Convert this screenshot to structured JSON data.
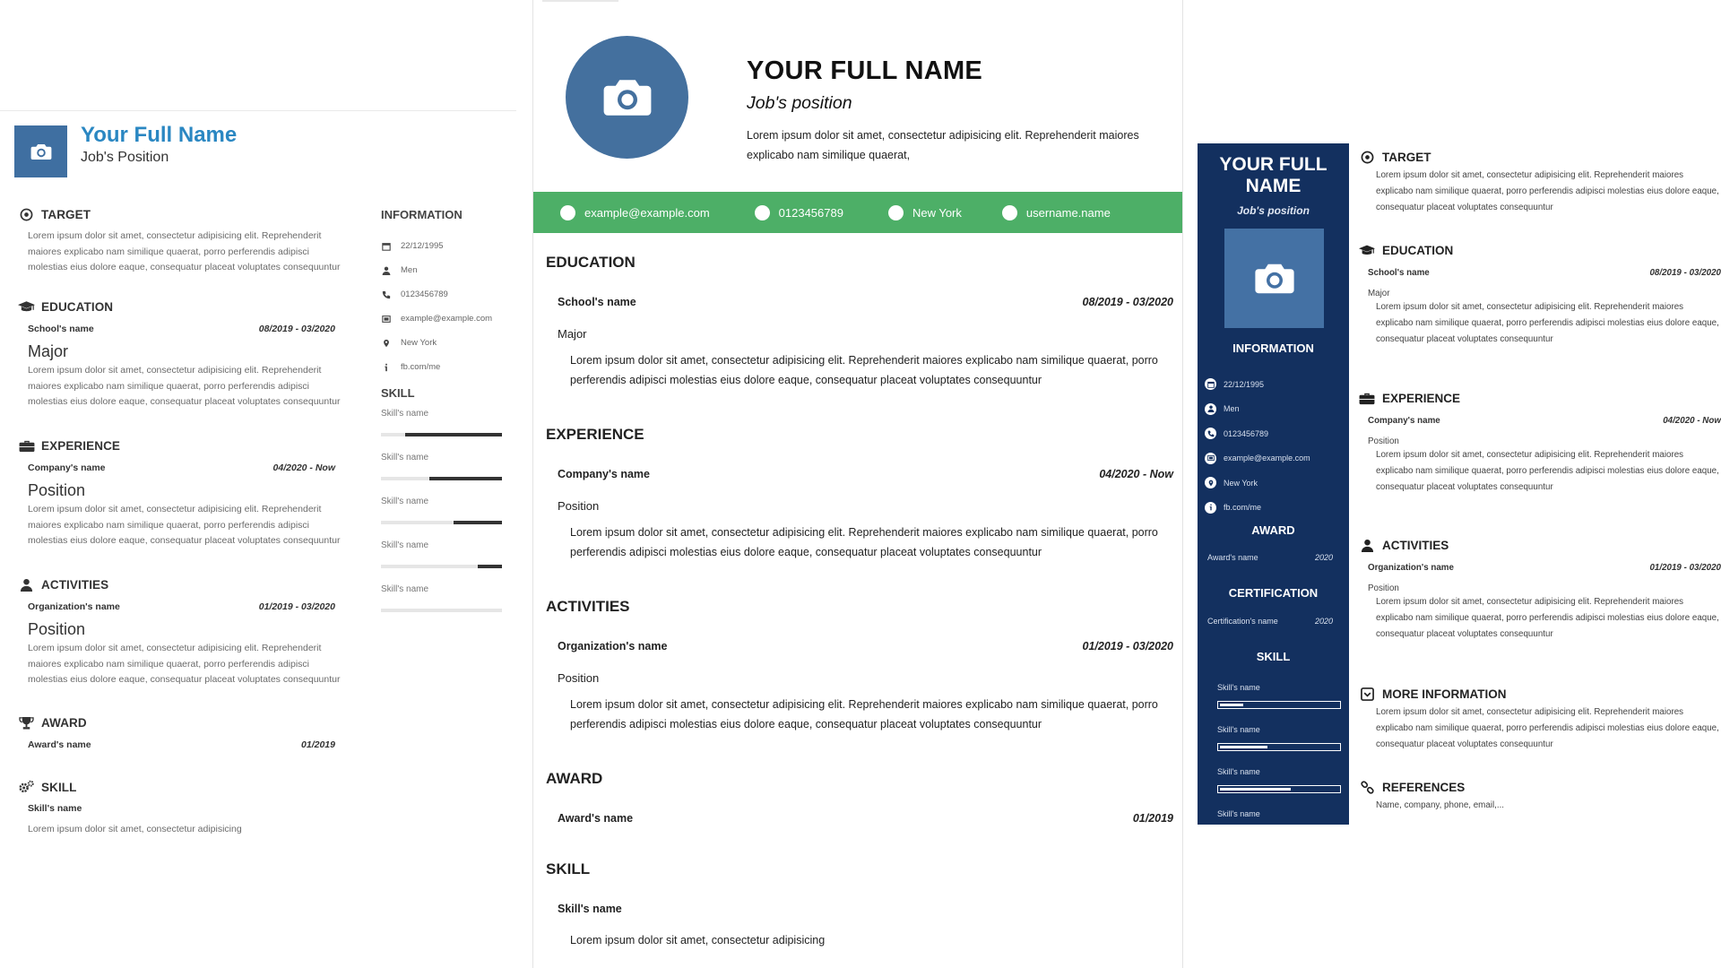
{
  "colors": {
    "cv1_accent": "#2a87c2",
    "cv1_photo_bg": "#3f6fa1",
    "cv2_photo_bg": "#44709e",
    "cv2_contact_bar": "#4daf67",
    "cv3_sidebar": "#13305f",
    "cv3_photo_bg": "#4471a4"
  },
  "icons": {
    "photo": "camera-icon",
    "target": "target-icon",
    "education": "graduation-cap-icon",
    "experience": "briefcase-icon",
    "activities": "user-icon",
    "award": "trophy-icon",
    "skill": "gears-icon",
    "more": "inbox-icon",
    "references": "link-icon"
  },
  "cv1": {
    "name": "Your Full Name",
    "position": "Job's Position",
    "target": {
      "title": "TARGET",
      "text": "Lorem ipsum dolor sit amet, consectetur adipisicing elit. Reprehenderit maiores explicabo nam similique quaerat, porro perferendis adipisci molestias eius dolore eaque, consequatur placeat voluptates consequuntur"
    },
    "education": {
      "title": "EDUCATION",
      "org": "School's name",
      "date": "08/2019 - 03/2020",
      "major": "Major",
      "text": "Lorem ipsum dolor sit amet, consectetur adipisicing elit. Reprehenderit maiores explicabo nam similique quaerat, porro perferendis adipisci molestias eius dolore eaque, consequatur placeat voluptates consequuntur"
    },
    "experience": {
      "title": "EXPERIENCE",
      "org": "Company's name",
      "date": "04/2020 - Now",
      "position": "Position",
      "text": "Lorem ipsum dolor sit amet, consectetur adipisicing elit. Reprehenderit maiores explicabo nam similique quaerat, porro perferendis adipisci molestias eius dolore eaque, consequatur placeat voluptates consequuntur"
    },
    "activities": {
      "title": "ACTIVITIES",
      "org": "Organization's name",
      "date": "01/2019 - 03/2020",
      "position": "Position",
      "text": "Lorem ipsum dolor sit amet, consectetur adipisicing elit. Reprehenderit maiores explicabo nam similique quaerat, porro perferendis adipisci molestias eius dolore eaque, consequatur placeat voluptates consequuntur"
    },
    "award": {
      "title": "AWARD",
      "name": "Award's name",
      "date": "01/2019"
    },
    "skill": {
      "title": "SKILL",
      "name": "Skill's name",
      "text": "Lorem ipsum dolor sit amet, consectetur adipisicing"
    },
    "information": {
      "title": "INFORMATION",
      "items": [
        {
          "icon": "calendar-icon",
          "text": "22/12/1995"
        },
        {
          "icon": "user-icon",
          "text": "Men"
        },
        {
          "icon": "phone-icon",
          "text": "0123456789"
        },
        {
          "icon": "envelope-icon",
          "text": "example@example.com"
        },
        {
          "icon": "map-pin-icon",
          "text": "New York"
        },
        {
          "icon": "info-icon",
          "text": "fb.com/me"
        }
      ]
    },
    "skills": {
      "title": "SKILL",
      "items": [
        {
          "label": "Skill's name",
          "level": 0.8
        },
        {
          "label": "Skill's name",
          "level": 0.6
        },
        {
          "label": "Skill's name",
          "level": 0.4
        },
        {
          "label": "Skill's name",
          "level": 0.2
        },
        {
          "label": "Skill's name",
          "level": 0.0
        }
      ]
    }
  },
  "cv2": {
    "name": "YOUR FULL NAME",
    "position": "Job's position",
    "summary": "Lorem ipsum dolor sit amet, consectetur adipisicing elit. Reprehenderit maiores explicabo nam similique quaerat,",
    "contacts": [
      "example@example.com",
      "0123456789",
      "New York",
      "username.name"
    ],
    "education": {
      "title": "EDUCATION",
      "org": "School's name",
      "date": "08/2019 - 03/2020",
      "sub": "Major",
      "text": "Lorem ipsum dolor sit amet, consectetur adipisicing elit. Reprehenderit maiores explicabo nam similique quaerat, porro perferendis adipisci molestias eius dolore eaque, consequatur placeat voluptates consequuntur"
    },
    "experience": {
      "title": "EXPERIENCE",
      "org": "Company's name",
      "date": "04/2020 - Now",
      "sub": "Position",
      "text": "Lorem ipsum dolor sit amet, consectetur adipisicing elit. Reprehenderit maiores explicabo nam similique quaerat, porro perferendis adipisci molestias eius dolore eaque, consequatur placeat voluptates consequuntur"
    },
    "activities": {
      "title": "ACTIVITIES",
      "org": "Organization's name",
      "date": "01/2019 - 03/2020",
      "sub": "Position",
      "text": "Lorem ipsum dolor sit amet, consectetur adipisicing elit. Reprehenderit maiores explicabo nam similique quaerat, porro perferendis adipisci molestias eius dolore eaque, consequatur placeat voluptates consequuntur"
    },
    "award": {
      "title": "AWARD",
      "name": "Award's name",
      "date": "01/2019"
    },
    "skill": {
      "title": "SKILL",
      "name": "Skill's name",
      "text": "Lorem ipsum dolor sit amet, consectetur adipisicing"
    }
  },
  "cv3": {
    "name_line1": "YOUR FULL",
    "name_line2": "NAME",
    "position": "Job's position",
    "information": {
      "title": "INFORMATION",
      "items": [
        {
          "icon": "calendar-icon",
          "text": "22/12/1995"
        },
        {
          "icon": "user-icon",
          "text": "Men"
        },
        {
          "icon": "phone-icon",
          "text": "0123456789"
        },
        {
          "icon": "envelope-icon",
          "text": "example@example.com"
        },
        {
          "icon": "map-pin-icon",
          "text": "New York"
        },
        {
          "icon": "info-icon",
          "text": "fb.com/me"
        }
      ]
    },
    "award": {
      "title": "AWARD",
      "name": "Award's name",
      "date": "2020"
    },
    "certification": {
      "title": "CERTIFICATION",
      "name": "Certification's name",
      "date": "2020"
    },
    "skills": {
      "title": "SKILL",
      "items": [
        {
          "label": "Skill's name",
          "level": 0.2
        },
        {
          "label": "Skill's name",
          "level": 0.4
        },
        {
          "label": "Skill's name",
          "level": 0.6
        },
        {
          "label": "Skill's name"
        }
      ]
    },
    "target": {
      "title": "TARGET",
      "text": "Lorem ipsum dolor sit amet, consectetur adipisicing elit. Reprehenderit maiores explicabo nam similique quaerat, porro perferendis adipisci molestias eius dolore eaque, consequatur placeat voluptates consequuntur"
    },
    "education": {
      "title": "EDUCATION",
      "org": "School's name",
      "date": "08/2019 - 03/2020",
      "sub": "Major",
      "text": "Lorem ipsum dolor sit amet, consectetur adipisicing elit. Reprehenderit maiores explicabo nam similique quaerat, porro perferendis adipisci molestias eius dolore eaque, consequatur placeat voluptates consequuntur"
    },
    "experience": {
      "title": "EXPERIENCE",
      "org": "Company's name",
      "date": "04/2020 - Now",
      "sub": "Position",
      "text": "Lorem ipsum dolor sit amet, consectetur adipisicing elit. Reprehenderit maiores explicabo nam similique quaerat, porro perferendis adipisci molestias eius dolore eaque, consequatur placeat voluptates consequuntur"
    },
    "activities": {
      "title": "ACTIVITIES",
      "org": "Organization's name",
      "date": "01/2019 - 03/2020",
      "sub": "Position",
      "text": "Lorem ipsum dolor sit amet, consectetur adipisicing elit. Reprehenderit maiores explicabo nam similique quaerat, porro perferendis adipisci molestias eius dolore eaque, consequatur placeat voluptates consequuntur"
    },
    "more": {
      "title": "MORE INFORMATION",
      "text": "Lorem ipsum dolor sit amet, consectetur adipisicing elit. Reprehenderit maiores explicabo nam similique quaerat, porro perferendis adipisci molestias eius dolore eaque, consequatur placeat voluptates consequuntur"
    },
    "references": {
      "title": "REFERENCES",
      "text": "Name, company, phone, email,..."
    }
  }
}
